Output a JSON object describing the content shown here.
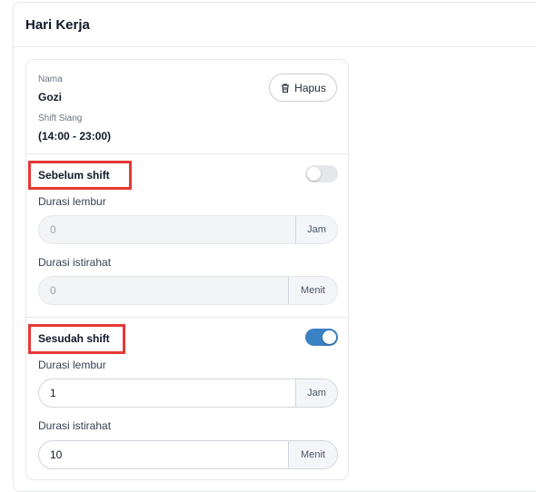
{
  "page": {
    "title": "Hari Kerja"
  },
  "employee": {
    "name_label": "Nama",
    "name": "Gozi",
    "shift_label": "Shift Siang",
    "shift_time": "(14:00 - 23:00)",
    "delete_label": "Hapus"
  },
  "before_shift": {
    "title": "Sebelum shift",
    "enabled": false,
    "overtime_label": "Durasi lembur",
    "overtime_value": "0",
    "overtime_unit": "Jam",
    "break_label": "Durasi istirahat",
    "break_value": "0",
    "break_unit": "Menit"
  },
  "after_shift": {
    "title": "Sesudah shift",
    "enabled": true,
    "overtime_label": "Durasi lembur",
    "overtime_value": "1",
    "overtime_unit": "Jam",
    "break_label": "Durasi istirahat",
    "break_value": "10",
    "break_unit": "Menit"
  },
  "colors": {
    "highlight": "#e53935",
    "toggle_on": "#3b82c4",
    "toggle_off": "#e5e7eb"
  }
}
